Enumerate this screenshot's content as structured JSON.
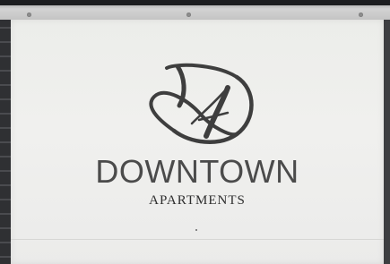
{
  "sign": {
    "brand_name": "DOWNTOWN",
    "brand_sub": "APARTMENTS",
    "logo_letters": "DA"
  },
  "colors": {
    "panel": "#efefed",
    "text": "#4b4b4b",
    "logo": "#3e3e3e",
    "wall": "#2f3033"
  }
}
